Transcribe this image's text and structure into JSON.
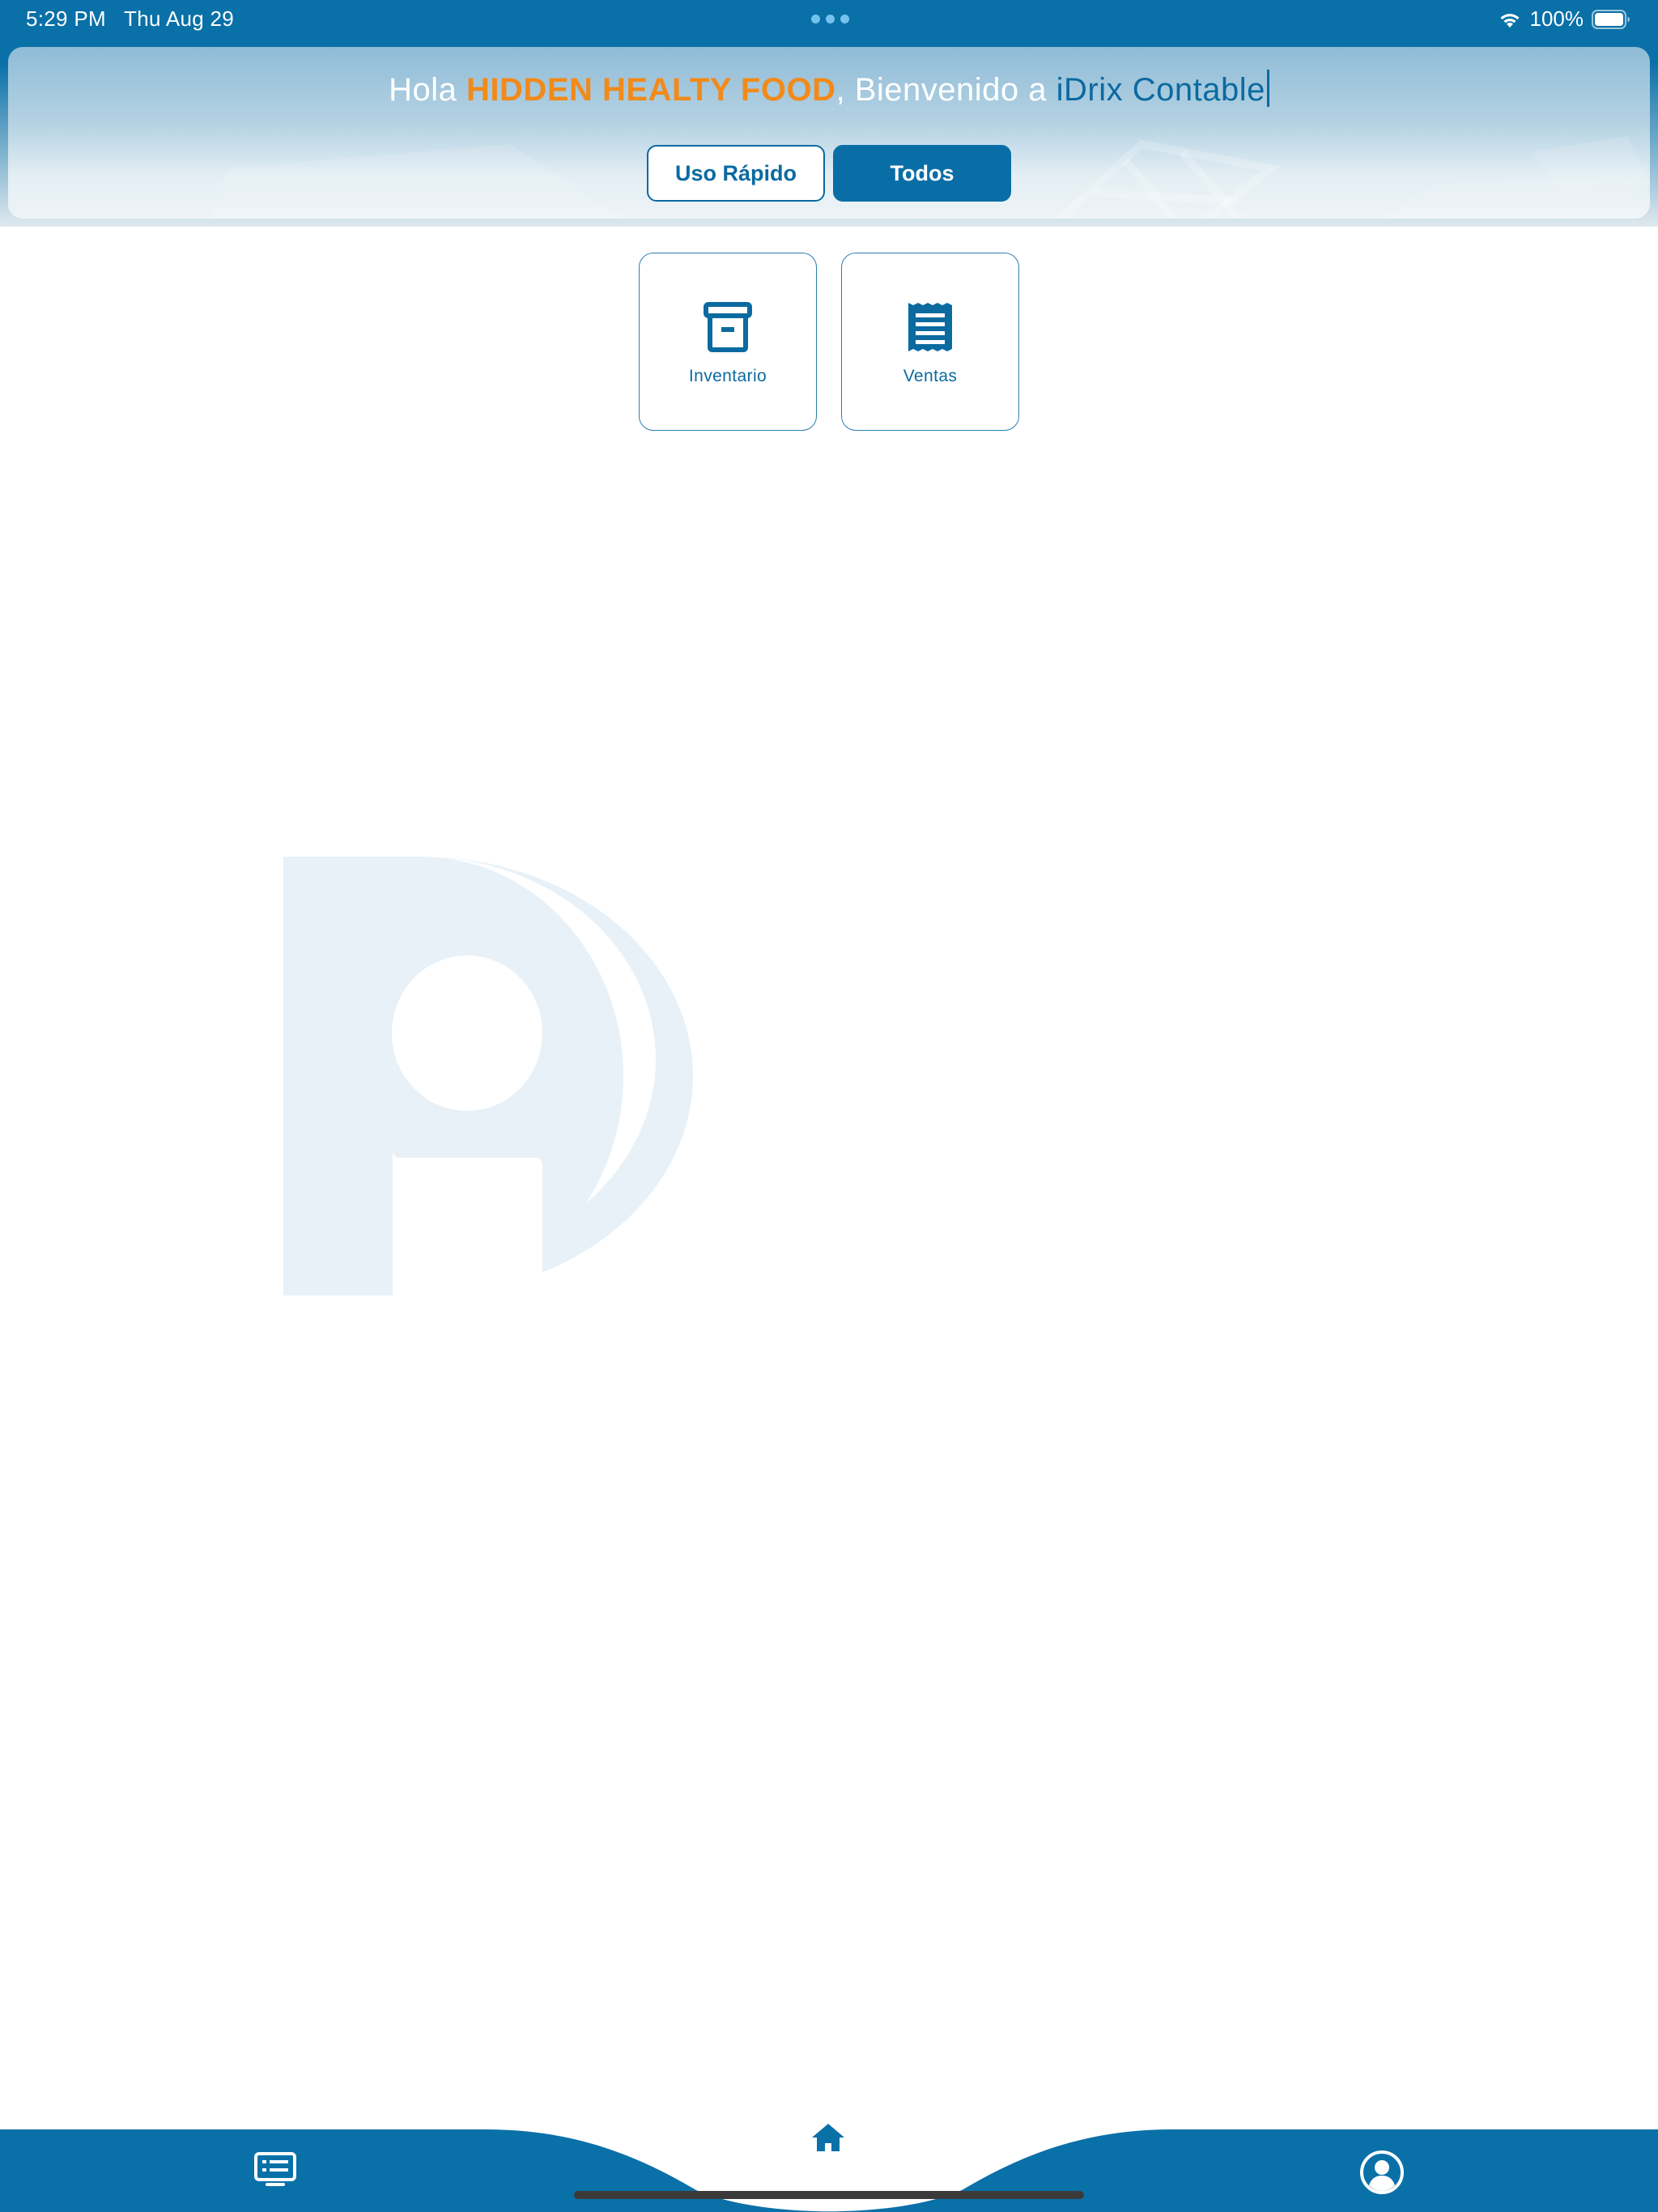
{
  "status_bar": {
    "time": "5:29 PM",
    "date": "Thu Aug 29",
    "battery_percent": "100%",
    "battery_level": 1.0,
    "wifi_icon": "wifi-icon",
    "battery_icon": "battery-icon"
  },
  "header": {
    "greeting_prefix": "Hola ",
    "company_name": "HIDDEN HEALTY FOOD",
    "greeting_middle": ", Bienvenido a ",
    "app_name": "iDrix Contable",
    "tabs": [
      {
        "label": "Uso Rápido",
        "selected": false
      },
      {
        "label": "Todos",
        "selected": true
      }
    ]
  },
  "modules": [
    {
      "label": "Inventario",
      "icon": "archive-box-icon"
    },
    {
      "label": "Ventas",
      "icon": "receipt-icon"
    }
  ],
  "bottom_nav": {
    "items": [
      {
        "icon": "list-screen-icon",
        "selected": false
      },
      {
        "icon": "home-icon",
        "selected": true
      },
      {
        "icon": "user-circle-icon",
        "selected": false
      }
    ]
  },
  "colors": {
    "primary": "#0a70a8",
    "accent_orange": "#f28a1a",
    "watermark": "#e8f1f7",
    "white": "#ffffff"
  }
}
